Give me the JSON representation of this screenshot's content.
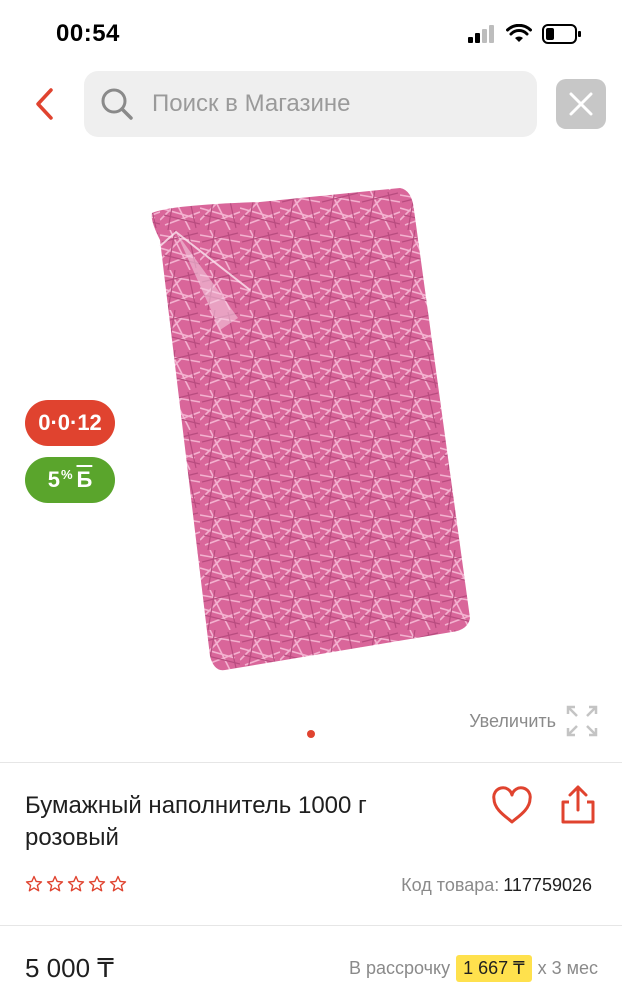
{
  "status_bar": {
    "time": "00:54",
    "icons": [
      "cellular-signal-icon",
      "wifi-icon",
      "battery-icon"
    ]
  },
  "search": {
    "placeholder": "Поиск в Магазине",
    "value": "",
    "icons": [
      "back-chevron-icon",
      "search-icon",
      "close-icon"
    ]
  },
  "gallery": {
    "badge_installment": "0·0·12",
    "badge_bonus_value": "5",
    "badge_bonus_percent": "%",
    "badge_bonus_currency": "Б",
    "zoom_label": "Увеличить",
    "image_count": 1,
    "active_index": 0,
    "accent_colors": {
      "installment": "#e0432f",
      "bonus": "#5aa52c",
      "product": "#d9669a"
    }
  },
  "product": {
    "title": "Бумажный наполнитель 1000 г розовый",
    "rating_stars_filled": 0,
    "rating_stars_total": 5,
    "code_label": "Код товара:",
    "code_value": "117759026",
    "price": "5 000 ₸",
    "installment_label": "В рассрочку",
    "installment_amount": "1 667 ₸",
    "installment_term": "х 3 мес"
  }
}
